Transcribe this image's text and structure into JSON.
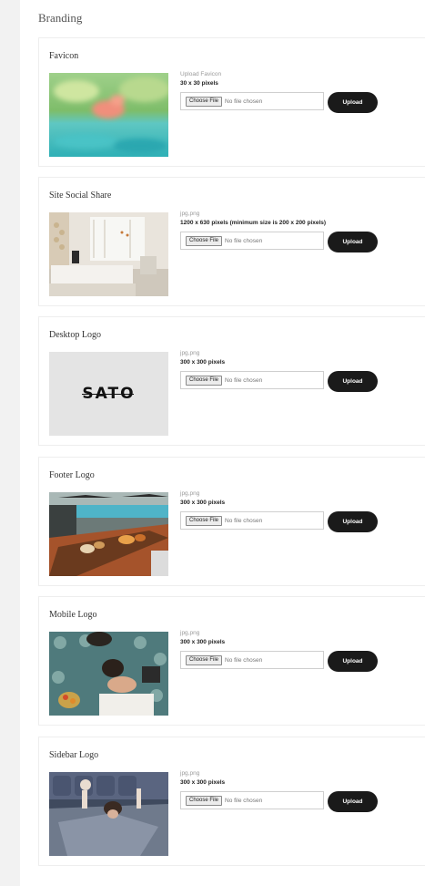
{
  "section_title": "Branding",
  "cards": [
    {
      "title": "Favicon",
      "file_types": "Upload Favicon",
      "dimensions": "30 x 30 pixels",
      "choose_label": "Choose File",
      "no_file": "No file chosen",
      "upload_label": "Upload",
      "image": "flamingo-pool-thumbnail"
    },
    {
      "title": "Site Social Share",
      "file_types": "jpg,png",
      "dimensions": "1200 x 630 pixels (minimum size is 200 x 200 pixels)",
      "choose_label": "Choose File",
      "no_file": "No file chosen",
      "upload_label": "Upload",
      "image": "hotel-room-thumbnail"
    },
    {
      "title": "Desktop Logo",
      "file_types": "jpg,png",
      "dimensions": "300 x 300 pixels",
      "choose_label": "Choose File",
      "no_file": "No file chosen",
      "upload_label": "Upload",
      "image": "sato-logo-thumbnail",
      "logo_text": "SATO"
    },
    {
      "title": "Footer Logo",
      "file_types": "jpg,png",
      "dimensions": "300 x 300 pixels",
      "choose_label": "Choose File",
      "no_file": "No file chosen",
      "upload_label": "Upload",
      "image": "poolside-dining-thumbnail"
    },
    {
      "title": "Mobile Logo",
      "file_types": "jpg,png",
      "dimensions": "300 x 300 pixels",
      "choose_label": "Choose File",
      "no_file": "No file chosen",
      "upload_label": "Upload",
      "image": "spa-massage-thumbnail"
    },
    {
      "title": "Sidebar Logo",
      "file_types": "jpg,png",
      "dimensions": "300 x 300 pixels",
      "choose_label": "Choose File",
      "no_file": "No file chosen",
      "upload_label": "Upload",
      "image": "bed-stretch-thumbnail"
    }
  ]
}
